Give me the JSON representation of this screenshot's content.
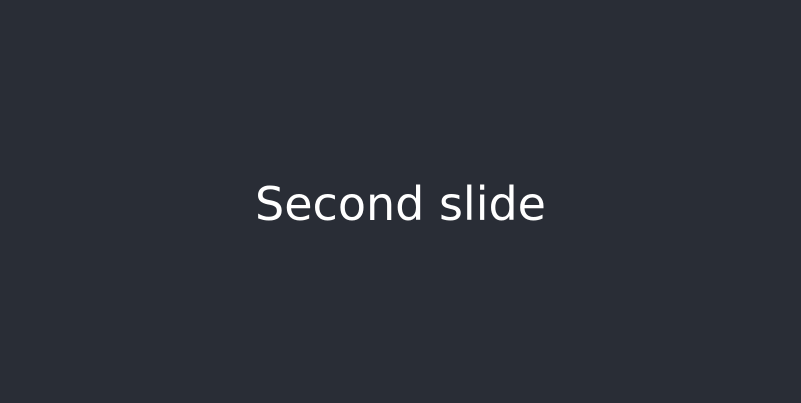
{
  "slide": {
    "caption": "Second slide",
    "background_color": "#292d36",
    "text_color": "#ffffff"
  }
}
